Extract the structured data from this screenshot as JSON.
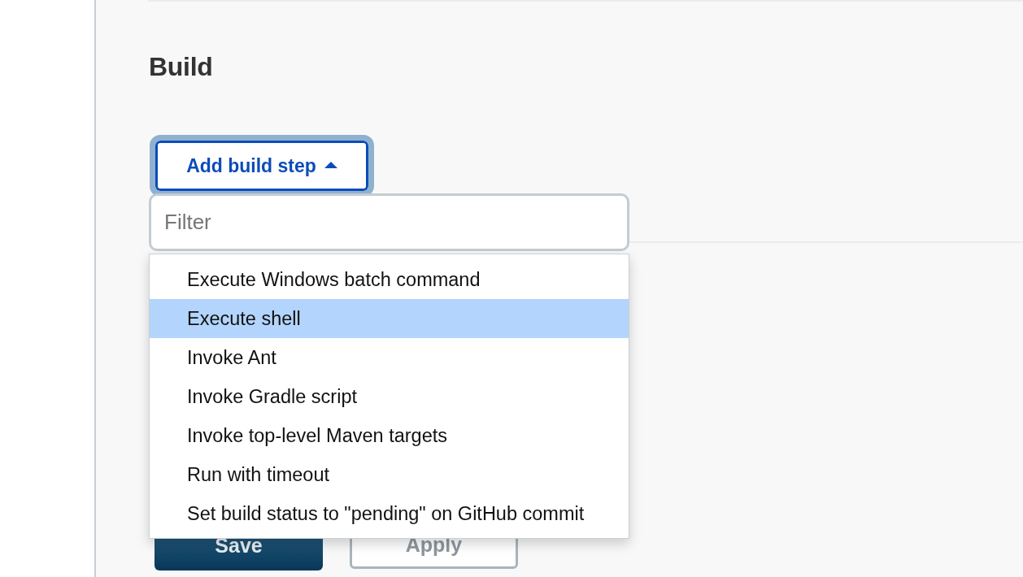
{
  "section": {
    "title": "Build"
  },
  "add_button": {
    "label": "Add build step",
    "expanded": true
  },
  "menu": {
    "filter": {
      "placeholder": "Filter"
    },
    "items": [
      {
        "label": "Execute Windows batch command",
        "selected": false
      },
      {
        "label": "Execute shell",
        "selected": true
      },
      {
        "label": "Invoke Ant",
        "selected": false
      },
      {
        "label": "Invoke Gradle script",
        "selected": false
      },
      {
        "label": "Invoke top-level Maven targets",
        "selected": false
      },
      {
        "label": "Run with timeout",
        "selected": false
      },
      {
        "label": "Set build status to \"pending\" on GitHub commit",
        "selected": false
      }
    ]
  },
  "actions": [
    {
      "label": "Save",
      "kind": "primary"
    },
    {
      "label": "Apply",
      "kind": "secondary"
    }
  ]
}
